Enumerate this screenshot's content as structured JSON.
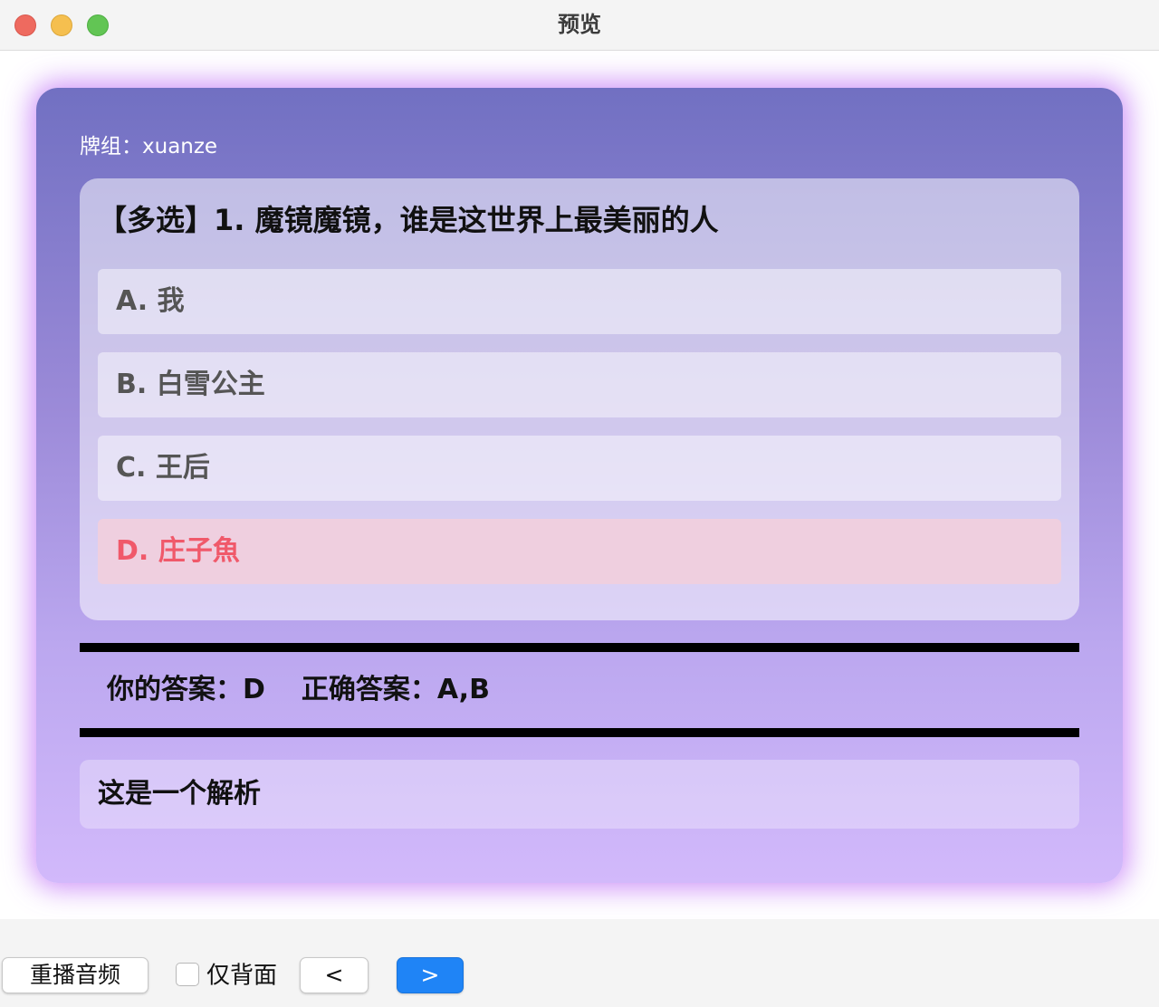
{
  "window": {
    "title": "预览"
  },
  "card": {
    "deck_label": "牌组：",
    "deck_name": "xuanze",
    "question": "【多选】1. 魔镜魔镜，谁是这世界上最美丽的人",
    "options": [
      {
        "label": "A. 我",
        "state": "normal"
      },
      {
        "label": "B. 白雪公主",
        "state": "normal"
      },
      {
        "label": "C. 王后",
        "state": "normal"
      },
      {
        "label": "D. 庄子魚",
        "state": "wrong"
      }
    ],
    "your_answer_label": "你的答案：",
    "your_answer": "D",
    "correct_answer_label": "正确答案：",
    "correct_answer": "A,B",
    "analysis": "这是一个解析"
  },
  "controls": {
    "replay_label": "重播音频",
    "back_only_label": "仅背面",
    "back_only_checked": false,
    "prev_label": "<",
    "next_label": ">"
  },
  "colors": {
    "accent": "#1f84f6",
    "wrong_text": "#f0596a",
    "wrong_bg": "#efcfdf"
  }
}
